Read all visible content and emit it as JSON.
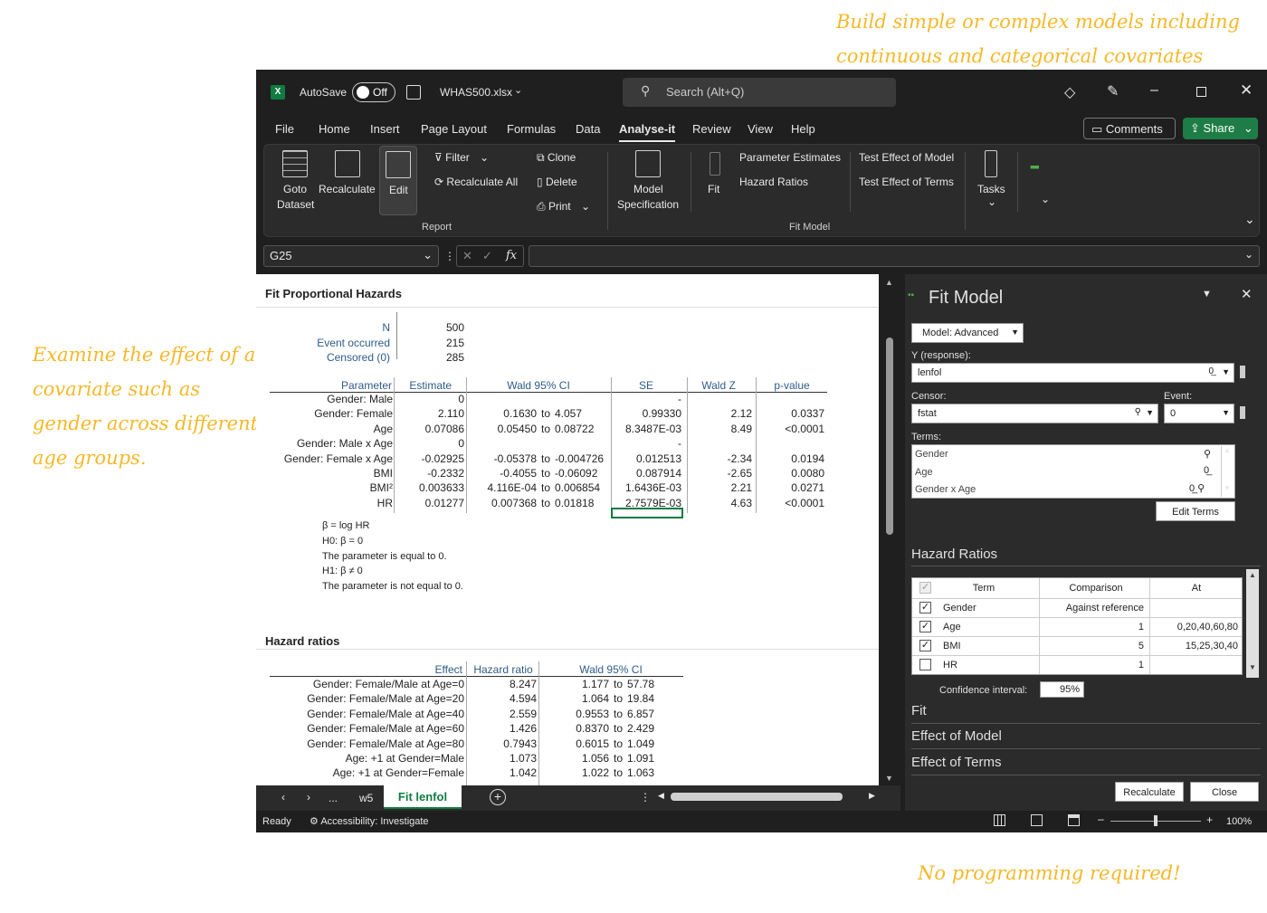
{
  "annotations": {
    "top": [
      "Build simple or complex models including",
      "continuous and categorical covariates"
    ],
    "left": [
      "Examine the effect of a",
      "covariate such as",
      "gender across different",
      "age groups."
    ],
    "bottom": "No programming required!"
  },
  "titlebar": {
    "autosave": "AutoSave",
    "toggle": "Off",
    "filename": "WHAS500.xlsx",
    "search_placeholder": "Search (Alt+Q)"
  },
  "menu": [
    "File",
    "Home",
    "Insert",
    "Page Layout",
    "Formulas",
    "Data",
    "Analyse-it",
    "Review",
    "View",
    "Help"
  ],
  "menu_active": "Analyse-it",
  "comments_label": "Comments",
  "share_label": "Share",
  "ribbon": {
    "goto": [
      "Goto",
      "Dataset"
    ],
    "recalculate": "Recalculate",
    "edit": "Edit",
    "filter": "Filter",
    "recalculate_all": "Recalculate All",
    "clone": "Clone",
    "delete": "Delete",
    "print": "Print",
    "report_group": "Report",
    "model_spec": [
      "Model",
      "Specification"
    ],
    "fit": "Fit",
    "parameter_estimates": "Parameter Estimates",
    "hazard_ratios": "Hazard Ratios",
    "test_effect_model": "Test Effect of Model",
    "test_effect_terms": "Test Effect of Terms",
    "fit_model_group": "Fit Model",
    "tasks": "Tasks"
  },
  "formula": {
    "namebox": "G25",
    "fx": "fx"
  },
  "report": {
    "title": "Fit Proportional Hazards",
    "summary": [
      {
        "label": "N",
        "value": "500"
      },
      {
        "label": "Event occurred",
        "value": "215"
      },
      {
        "label": "Censored (0)",
        "value": "285"
      }
    ],
    "param_headers": [
      "Parameter",
      "Estimate",
      "Wald 95% CI",
      "SE",
      "Wald Z",
      "p-value"
    ],
    "params": [
      {
        "p": "Gender: Male",
        "e": "0",
        "lo": "",
        "to": "",
        "hi": "",
        "se": "-",
        "z": "",
        "pv": ""
      },
      {
        "p": "Gender: Female",
        "e": "2.110",
        "lo": "0.1630",
        "to": "to",
        "hi": "4.057",
        "se": "0.99330",
        "z": "2.12",
        "pv": "0.0337"
      },
      {
        "p": "Age",
        "e": "0.07086",
        "lo": "0.05450",
        "to": "to",
        "hi": "0.08722",
        "se": "8.3487E-03",
        "z": "8.49",
        "pv": "<0.0001"
      },
      {
        "p": "Gender: Male x Age",
        "e": "0",
        "lo": "",
        "to": "",
        "hi": "",
        "se": "-",
        "z": "",
        "pv": ""
      },
      {
        "p": "Gender: Female x Age",
        "e": "-0.02925",
        "lo": "-0.05378",
        "to": "to",
        "hi": "-0.004726",
        "se": "0.012513",
        "z": "-2.34",
        "pv": "0.0194"
      },
      {
        "p": "BMI",
        "e": "-0.2332",
        "lo": "-0.4055",
        "to": "to",
        "hi": "-0.06092",
        "se": "0.087914",
        "z": "-2.65",
        "pv": "0.0080"
      },
      {
        "p": "BMI²",
        "e": "0.003633",
        "lo": "4.116E-04",
        "to": "to",
        "hi": "0.006854",
        "se": "1.6436E-03",
        "z": "2.21",
        "pv": "0.0271"
      },
      {
        "p": "HR",
        "e": "0.01277",
        "lo": "0.007368",
        "to": "to",
        "hi": "0.01818",
        "se": "2.7579E-03",
        "z": "4.63",
        "pv": "<0.0001"
      }
    ],
    "notes": [
      "β = log HR",
      "H0: β = 0",
      "The parameter is equal to 0.",
      "H1: β ≠ 0",
      "The parameter is not equal to 0."
    ],
    "hr_title": "Hazard ratios",
    "hr_headers": [
      "Effect",
      "Hazard ratio",
      "Wald 95% CI"
    ],
    "hr_rows": [
      {
        "eff": "Gender: Female/Male at Age=0",
        "hr": "8.247",
        "lo": "1.177",
        "to": "to",
        "hi": "57.78"
      },
      {
        "eff": "Gender: Female/Male at Age=20",
        "hr": "4.594",
        "lo": "1.064",
        "to": "to",
        "hi": "19.84"
      },
      {
        "eff": "Gender: Female/Male at Age=40",
        "hr": "2.559",
        "lo": "0.9553",
        "to": "to",
        "hi": "6.857"
      },
      {
        "eff": "Gender: Female/Male at Age=60",
        "hr": "1.426",
        "lo": "0.8370",
        "to": "to",
        "hi": "2.429"
      },
      {
        "eff": "Gender: Female/Male at Age=80",
        "hr": "0.7943",
        "lo": "0.6015",
        "to": "to",
        "hi": "1.049"
      },
      {
        "eff": "Age: +1 at Gender=Male",
        "hr": "1.073",
        "lo": "1.056",
        "to": "to",
        "hi": "1.091"
      },
      {
        "eff": "Age: +1 at Gender=Female",
        "hr": "1.042",
        "lo": "1.022",
        "to": "to",
        "hi": "1.063"
      }
    ]
  },
  "tabs": {
    "ellipsis": "...",
    "w5": "w5",
    "active": "Fit lenfol"
  },
  "status": {
    "ready": "Ready",
    "accessibility": "Accessibility: Investigate",
    "zoom": "100%"
  },
  "pane": {
    "title": "Fit Model",
    "model": "Model: Advanced",
    "y_label": "Y (response):",
    "y_value": "lenfol",
    "censor_label": "Censor:",
    "censor_value": "fstat",
    "event_label": "Event:",
    "event_value": "0",
    "terms_label": "Terms:",
    "terms": [
      "Gender",
      "Age",
      "Gender x Age"
    ],
    "edit_terms": "Edit Terms",
    "hr_section": "Hazard Ratios",
    "grid_headers": [
      "Term",
      "Comparison",
      "At"
    ],
    "grid_rows": [
      {
        "checked": true,
        "term": "Gender",
        "comp": "Against reference",
        "at": ""
      },
      {
        "checked": true,
        "term": "Age",
        "comp": "1",
        "at": "0,20,40,60,80"
      },
      {
        "checked": true,
        "term": "BMI",
        "comp": "5",
        "at": "15,25,30,40"
      },
      {
        "checked": false,
        "term": "HR",
        "comp": "1",
        "at": ""
      }
    ],
    "ci_label": "Confidence interval:",
    "ci_value": "95%",
    "fit_section": "Fit",
    "effect_model": "Effect of Model",
    "effect_terms": "Effect of Terms",
    "recalculate": "Recalculate",
    "close": "Close"
  }
}
